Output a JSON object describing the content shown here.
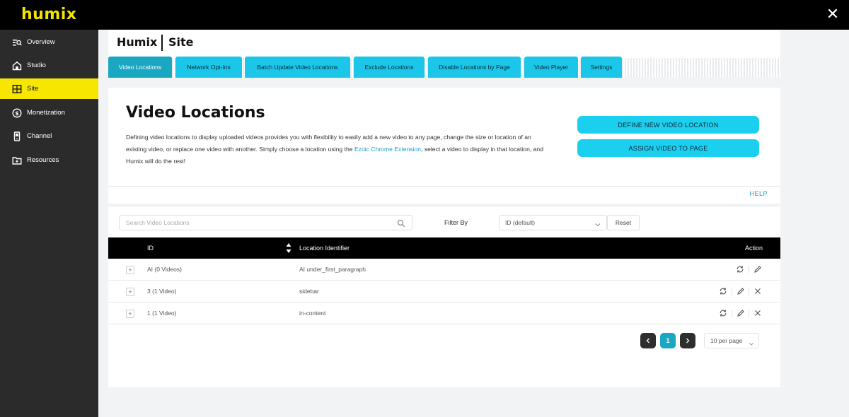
{
  "app": {
    "logo": "humix",
    "close_icon": "close-icon"
  },
  "sidebar": {
    "items": [
      {
        "label": "Overview",
        "icon": "overview-icon",
        "active": false
      },
      {
        "label": "Studio",
        "icon": "home-icon",
        "active": false
      },
      {
        "label": "Site",
        "icon": "site-grid-icon",
        "active": true
      },
      {
        "label": "Monetization",
        "icon": "dollar-icon",
        "active": false
      },
      {
        "label": "Channel",
        "icon": "phone-icon",
        "active": false
      },
      {
        "label": "Resources",
        "icon": "folder-icon",
        "active": false
      }
    ]
  },
  "header": {
    "title": "Humix",
    "subtitle": "Site"
  },
  "tabs": [
    {
      "label": "Video Locations",
      "active": true
    },
    {
      "label": "Network Opt-Ins",
      "active": false
    },
    {
      "label": "Batch Update Video Locations",
      "active": false
    },
    {
      "label": "Exclude Locations",
      "active": false
    },
    {
      "label": "Disable Locations by Page",
      "active": false
    },
    {
      "label": "Video Player",
      "active": false
    },
    {
      "label": "Settings",
      "active": false
    }
  ],
  "info": {
    "title": "Video Locations",
    "text_before_link": "Defining video locations to display uploaded videos provides you with flexibility to easily add a new video to any page, change the size or location of an existing video, or replace one video with another. Simply choose a location using the ",
    "link": "Ezoic Chrome Extension",
    "text_after_link": ", select a video to display in that location, and Humix will do the rest!",
    "define_button": "DEFINE NEW VIDEO LOCATION",
    "assign_button": "ASSIGN VIDEO TO PAGE"
  },
  "help": {
    "label": "HELP"
  },
  "search": {
    "placeholder": "Search Video Locations",
    "value": ""
  },
  "filter": {
    "label": "Filter By",
    "selected": "ID (default)",
    "reset": "Reset"
  },
  "table": {
    "headers": {
      "id": "ID",
      "location": "Location Identifier",
      "action": "Action"
    },
    "rows": [
      {
        "id": "AI (0 Videos)",
        "location": "AI under_first_paragraph",
        "actions": [
          "sync",
          "edit"
        ]
      },
      {
        "id": "3 (1 Video)",
        "location": "sidebar",
        "actions": [
          "sync",
          "edit",
          "delete"
        ]
      },
      {
        "id": "1 (1 Video)",
        "location": "in-content",
        "actions": [
          "sync",
          "edit",
          "delete"
        ]
      }
    ]
  },
  "pagination": {
    "current": "1",
    "per_page": "10 per page"
  },
  "colors": {
    "accent_yellow": "#f7e600",
    "tab_cyan": "#1bc6e8",
    "tab_active": "#1aa7c2",
    "button_cyan": "#1bd0ef",
    "link": "#1a9cc0"
  }
}
